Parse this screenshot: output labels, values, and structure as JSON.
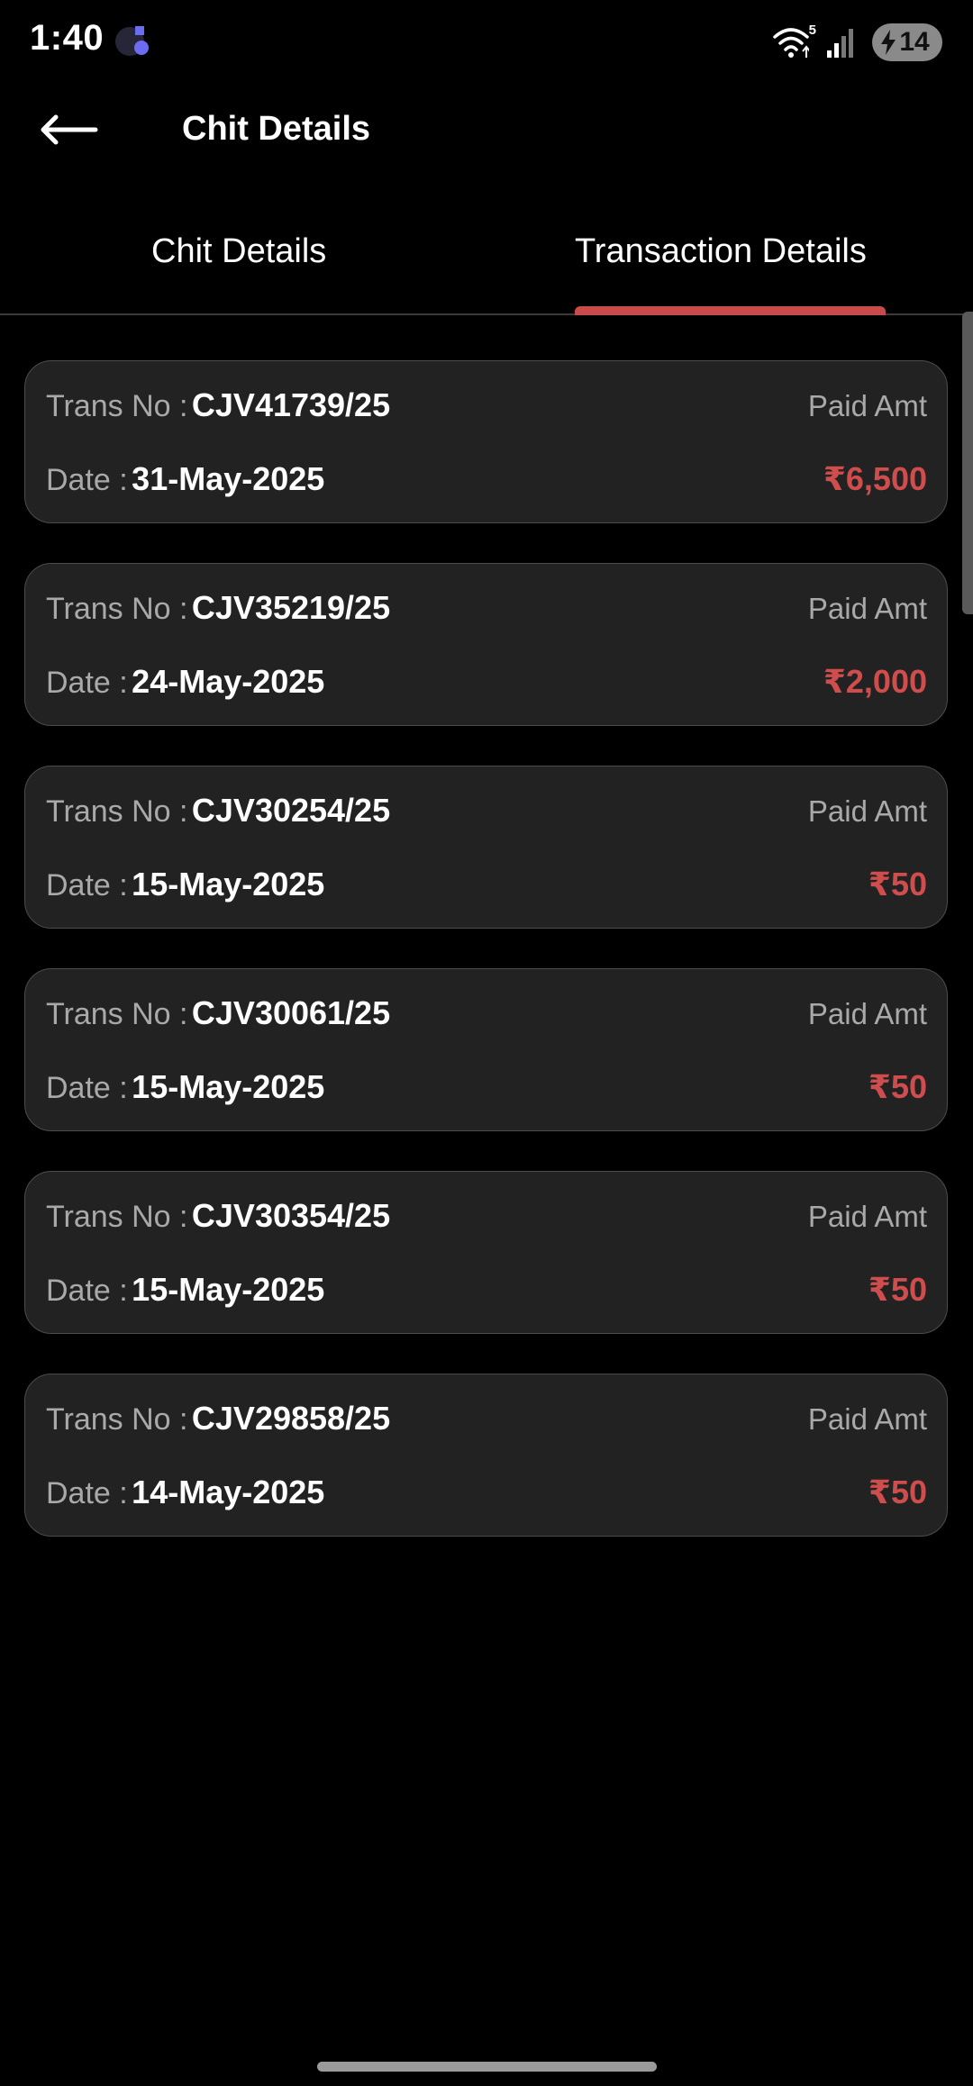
{
  "status_bar": {
    "time": "1:40",
    "app_icon": "assistant-app-icon",
    "wifi_label": "5",
    "battery_level": "14"
  },
  "app_bar": {
    "back_icon": "arrow-left-icon",
    "title": "Chit Details"
  },
  "tabs": [
    {
      "label": "Chit Details",
      "active": false
    },
    {
      "label": "Transaction Details",
      "active": true
    }
  ],
  "colors": {
    "accent": "#c94a4a",
    "amount": "#cf4d4d",
    "card_bg": "#222222",
    "background": "#000000"
  },
  "labels": {
    "trans_no": "Trans No :",
    "date": "Date :",
    "paid_amt": "Paid Amt"
  },
  "transactions": [
    {
      "trans_no": "CJV41739/25",
      "date": "31-May-2025",
      "amount": "₹6,500"
    },
    {
      "trans_no": "CJV35219/25",
      "date": "24-May-2025",
      "amount": "₹2,000"
    },
    {
      "trans_no": "CJV30254/25",
      "date": "15-May-2025",
      "amount": "₹50"
    },
    {
      "trans_no": "CJV30061/25",
      "date": "15-May-2025",
      "amount": "₹50"
    },
    {
      "trans_no": "CJV30354/25",
      "date": "15-May-2025",
      "amount": "₹50"
    },
    {
      "trans_no": "CJV29858/25",
      "date": "14-May-2025",
      "amount": "₹50"
    }
  ]
}
